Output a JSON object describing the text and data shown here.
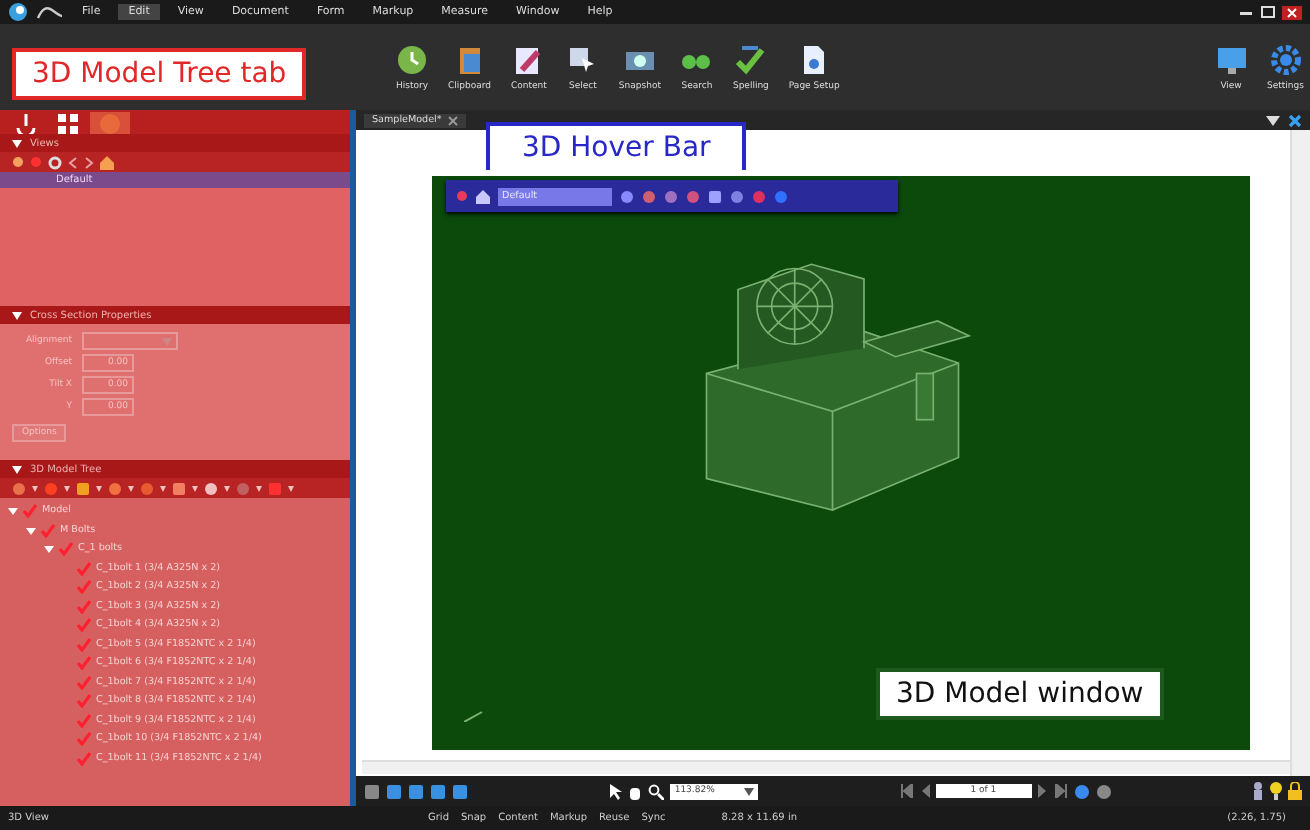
{
  "menu": [
    {
      "label": "File",
      "selected": false
    },
    {
      "label": "Edit",
      "selected": true
    },
    {
      "label": "View",
      "selected": false
    },
    {
      "label": "Document",
      "selected": false
    },
    {
      "label": "Form",
      "selected": false
    },
    {
      "label": "Markup",
      "selected": false
    },
    {
      "label": "Measure",
      "selected": false
    },
    {
      "label": "Window",
      "selected": false
    },
    {
      "label": "Help",
      "selected": false
    }
  ],
  "ribbon": {
    "left": [
      "History",
      "Clipboard",
      "Content",
      "Select",
      "Snapshot",
      "Search",
      "Spelling",
      "Page Setup"
    ],
    "right": [
      "View",
      "Settings"
    ]
  },
  "left_panel": {
    "tabs": [
      {
        "selected": false
      },
      {
        "selected": false
      },
      {
        "selected": true
      }
    ],
    "views": {
      "title": "Views",
      "items": [
        {
          "label": "Default",
          "selected": true
        }
      ]
    },
    "cross_section": {
      "title": "Cross Section Properties",
      "fields": [
        {
          "label": "Alignment",
          "kind": "dropdown"
        },
        {
          "label": "Offset",
          "kind": "spinner",
          "value": "0.00"
        },
        {
          "label": "Tilt X",
          "kind": "spinner",
          "value": "0.00"
        },
        {
          "label": "Y",
          "kind": "spinner",
          "value": "0.00"
        }
      ],
      "button": "Options"
    },
    "model_tree": {
      "title": "3D Model Tree",
      "nodes": [
        {
          "label": "Model",
          "checked": true,
          "expanded": true,
          "children": [
            {
              "label": "M Bolts",
              "checked": true,
              "expanded": true,
              "children": [
                {
                  "label": "C_1 bolts",
                  "checked": true,
                  "expanded": true,
                  "children": [
                    {
                      "label": "C_1bolt 1 (3/4 A325N x 2)",
                      "checked": true
                    },
                    {
                      "label": "C_1bolt 2 (3/4 A325N x 2)",
                      "checked": true
                    },
                    {
                      "label": "C_1bolt 3 (3/4 A325N x 2)",
                      "checked": true
                    },
                    {
                      "label": "C_1bolt 4 (3/4 A325N x 2)",
                      "checked": true
                    },
                    {
                      "label": "C_1bolt 5 (3/4 F1852NTC x 2 1/4)",
                      "checked": true
                    },
                    {
                      "label": "C_1bolt 6 (3/4 F1852NTC x 2 1/4)",
                      "checked": true
                    },
                    {
                      "label": "C_1bolt 7 (3/4 F1852NTC x 2 1/4)",
                      "checked": true
                    },
                    {
                      "label": "C_1bolt 8 (3/4 F1852NTC x 2 1/4)",
                      "checked": true
                    },
                    {
                      "label": "C_1bolt 9 (3/4 F1852NTC x 2 1/4)",
                      "checked": true
                    },
                    {
                      "label": "C_1bolt 10 (3/4 F1852NTC x 2 1/4)",
                      "checked": true
                    },
                    {
                      "label": "C_1bolt 11 (3/4 F1852NTC x 2 1/4)",
                      "checked": true
                    }
                  ]
                }
              ]
            }
          ]
        }
      ]
    }
  },
  "document": {
    "tab": "SampleModel*",
    "hover_bar": {
      "view": "Default"
    },
    "zoom": "113.82%",
    "page": "1 of 1"
  },
  "status_bar": {
    "mode": "3D View",
    "toggles": [
      "Grid",
      "Snap",
      "Content",
      "Markup",
      "Reuse",
      "Sync"
    ],
    "size": "8.28 x 11.69 in",
    "coords": "(2.26, 1.75)"
  },
  "annotations": [
    {
      "text": "3D Model Tree tab",
      "color": "#e02828"
    },
    {
      "text": "3D Hover Bar",
      "color": "#2828c8"
    },
    {
      "text": "3D Model window",
      "color": "#1e5a1e"
    }
  ]
}
